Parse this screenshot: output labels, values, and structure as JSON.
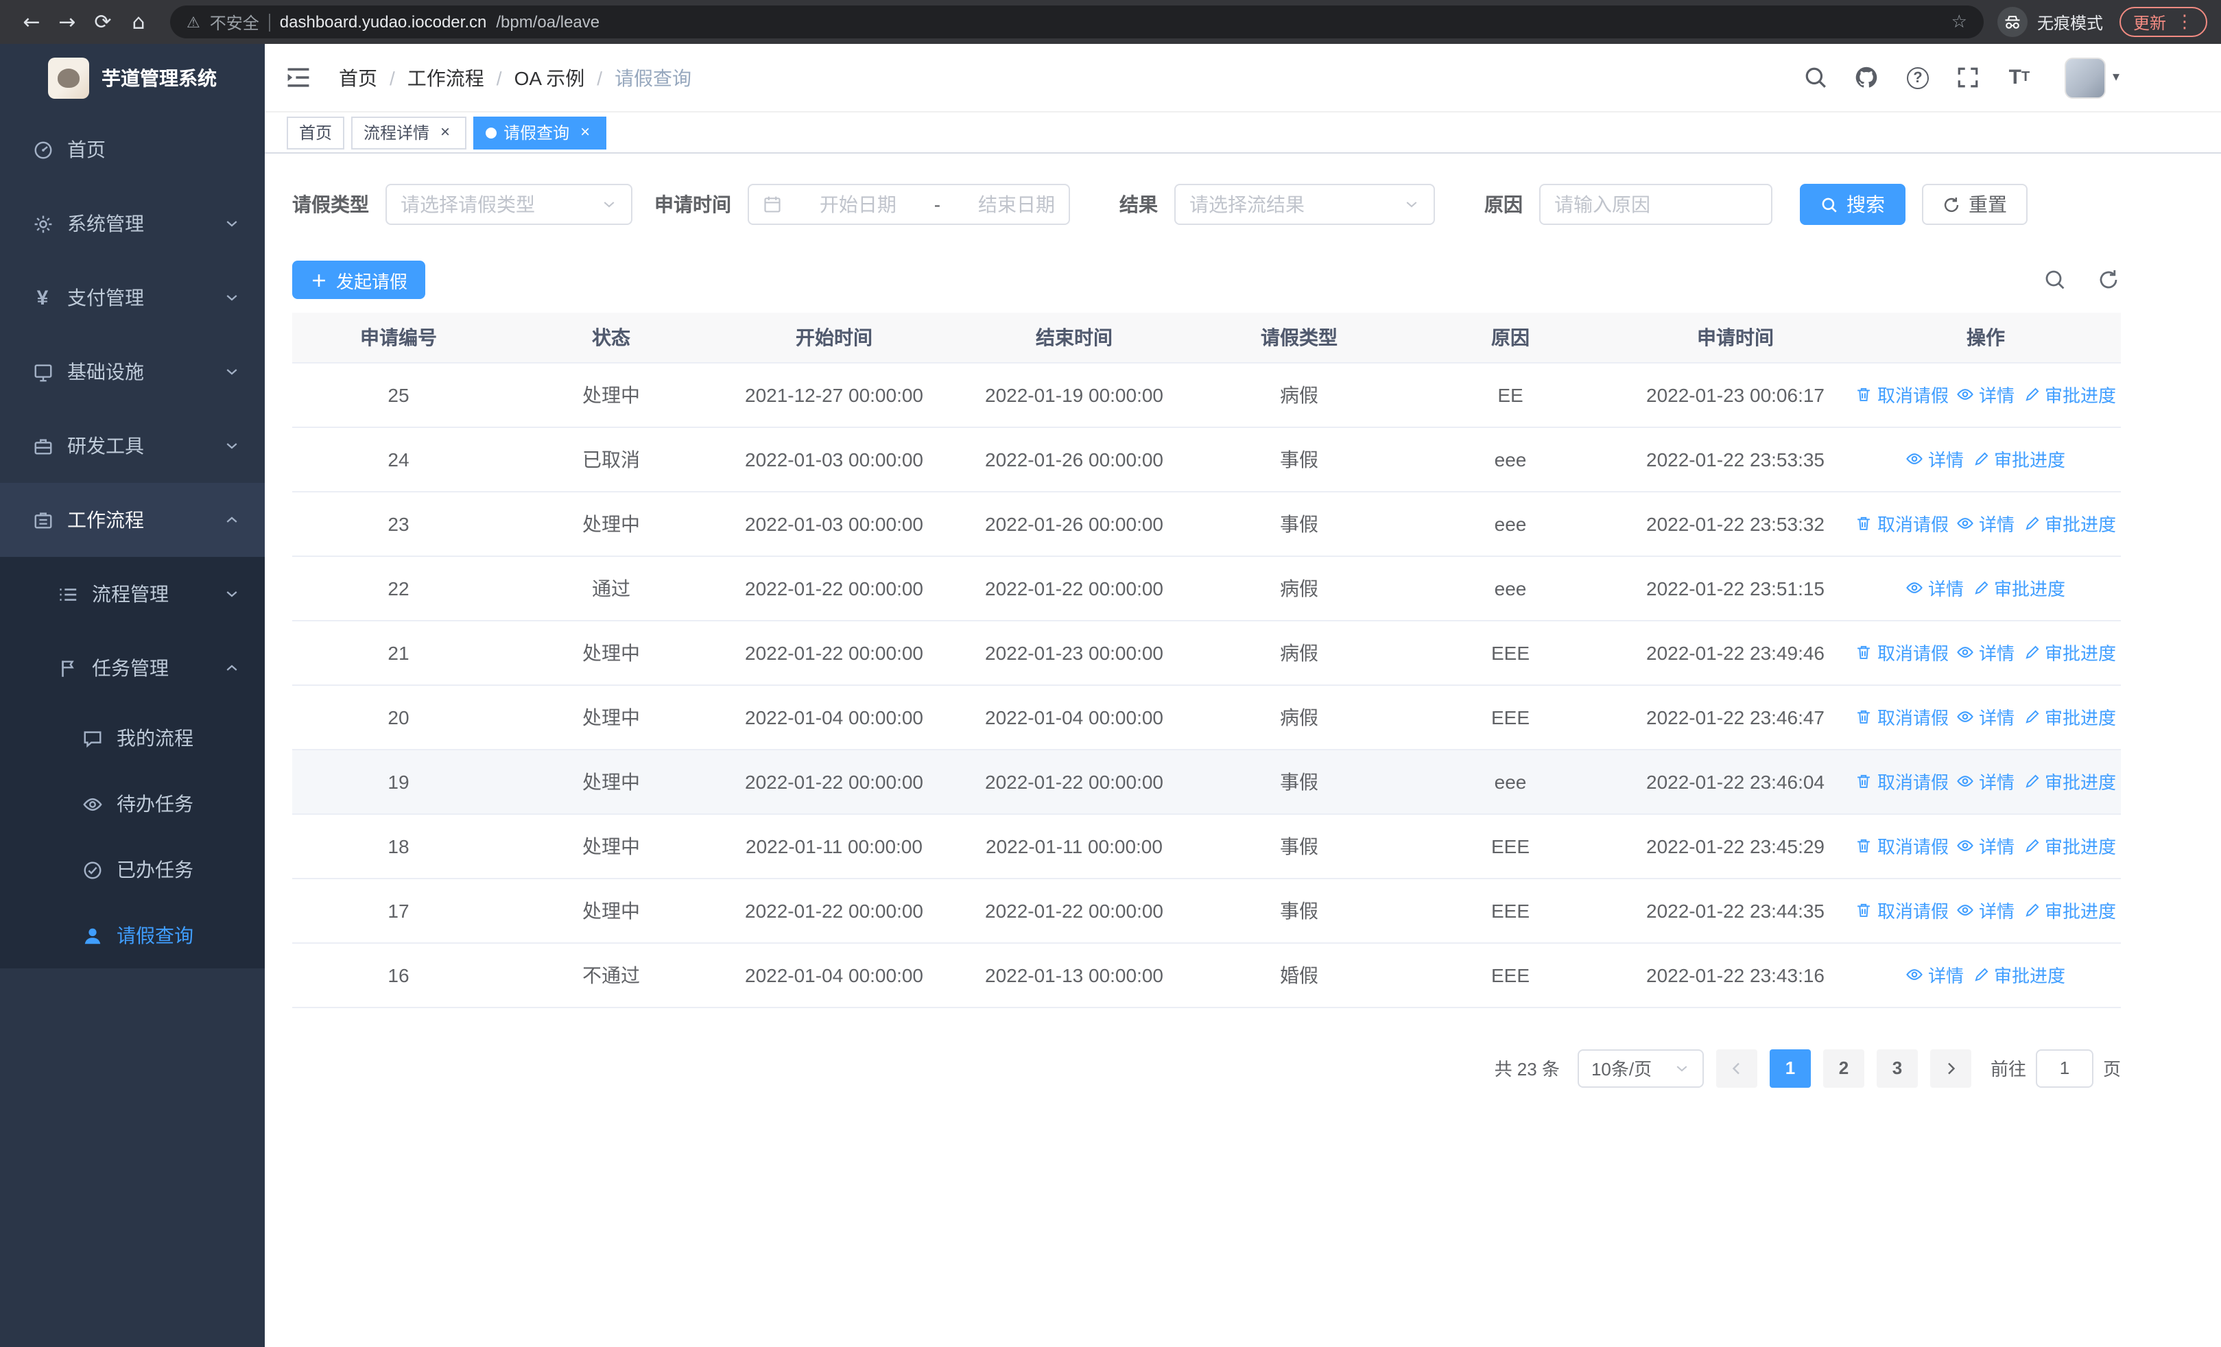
{
  "icons": {
    "back": "←",
    "forward": "→",
    "refresh": "⟳",
    "home": "⌂",
    "star": "☆",
    "kebab": "⋮",
    "warning": "⚠",
    "caret_down": "▾"
  },
  "browser": {
    "security_label": "不安全",
    "url_domain": "dashboard.yudao.iocoder.cn",
    "url_path": "/bpm/oa/leave",
    "incognito_label": "无痕模式",
    "update_label": "更新"
  },
  "sidebar": {
    "app_title": "芋道管理系统",
    "menu": [
      {
        "name": "home",
        "label": "首页",
        "icon": "dashboard-icon",
        "level": 1
      },
      {
        "name": "system",
        "label": "系统管理",
        "icon": "gear-icon",
        "level": 1,
        "chevron": "down"
      },
      {
        "name": "payment",
        "label": "支付管理",
        "icon": "payment-icon",
        "level": 1,
        "chevron": "down"
      },
      {
        "name": "infra",
        "label": "基础设施",
        "icon": "infra-icon",
        "level": 1,
        "chevron": "down"
      },
      {
        "name": "devtools",
        "label": "研发工具",
        "icon": "devtools-icon",
        "level": 1,
        "chevron": "down"
      },
      {
        "name": "workflow",
        "label": "工作流程",
        "icon": "workflow-icon",
        "level": 1,
        "chevron": "up",
        "highlight": true
      },
      {
        "name": "process-mgmt",
        "label": "流程管理",
        "icon": "process-icon",
        "level": 2,
        "chevron": "down",
        "submenu": true
      },
      {
        "name": "task-mgmt",
        "label": "任务管理",
        "icon": "task-icon",
        "level": 2,
        "chevron": "up",
        "submenu": true
      },
      {
        "name": "my-process",
        "label": "我的流程",
        "icon": "chat-icon",
        "level": 3,
        "submenu": true
      },
      {
        "name": "todo-tasks",
        "label": "待办任务",
        "icon": "eye-icon",
        "level": 3,
        "submenu": true
      },
      {
        "name": "done-tasks",
        "label": "已办任务",
        "icon": "check-icon",
        "level": 3,
        "submenu": true
      },
      {
        "name": "leave-query",
        "label": "请假查询",
        "icon": "user-icon",
        "level": 3,
        "submenu": true,
        "active": true
      }
    ]
  },
  "breadcrumb": [
    "首页",
    "工作流程",
    "OA 示例",
    "请假查询"
  ],
  "breadcrumb_separator": "/",
  "tabs": [
    {
      "label": "首页"
    },
    {
      "label": "流程详情",
      "closable": true
    },
    {
      "label": "请假查询",
      "closable": true,
      "active": true
    }
  ],
  "tab_close_glyph": "×",
  "filters": {
    "leave_type_label": "请假类型",
    "leave_type_placeholder": "请选择请假类型",
    "apply_time_label": "申请时间",
    "start_date_placeholder": "开始日期",
    "date_separator": "-",
    "end_date_placeholder": "结束日期",
    "result_label": "结果",
    "result_placeholder": "请选择流结果",
    "reason_label": "原因",
    "reason_placeholder": "请输入原因",
    "search_button": "搜索",
    "reset_button": "重置"
  },
  "toolbar": {
    "create_button": "发起请假"
  },
  "table": {
    "columns": [
      "申请编号",
      "状态",
      "开始时间",
      "结束时间",
      "请假类型",
      "原因",
      "申请时间",
      "操作"
    ],
    "rows": [
      {
        "no": "25",
        "status": "处理中",
        "start": "2021-12-27 00:00:00",
        "end": "2022-01-19 00:00:00",
        "type": "病假",
        "reason": "EE",
        "applied": "2022-01-23 00:06:17",
        "actions": [
          {
            "name": "cancel",
            "icon": "trash-icon",
            "label": "取消请假"
          },
          {
            "name": "detail",
            "icon": "eye-icon",
            "label": "详情"
          },
          {
            "name": "progress",
            "icon": "edit-icon",
            "label": "审批进度"
          }
        ]
      },
      {
        "no": "24",
        "status": "已取消",
        "start": "2022-01-03 00:00:00",
        "end": "2022-01-26 00:00:00",
        "type": "事假",
        "reason": "eee",
        "applied": "2022-01-22 23:53:35",
        "actions": [
          {
            "name": "detail",
            "icon": "eye-icon",
            "label": "详情"
          },
          {
            "name": "progress",
            "icon": "edit-icon",
            "label": "审批进度"
          }
        ]
      },
      {
        "no": "23",
        "status": "处理中",
        "start": "2022-01-03 00:00:00",
        "end": "2022-01-26 00:00:00",
        "type": "事假",
        "reason": "eee",
        "applied": "2022-01-22 23:53:32",
        "actions": [
          {
            "name": "cancel",
            "icon": "trash-icon",
            "label": "取消请假"
          },
          {
            "name": "detail",
            "icon": "eye-icon",
            "label": "详情"
          },
          {
            "name": "progress",
            "icon": "edit-icon",
            "label": "审批进度"
          }
        ]
      },
      {
        "no": "22",
        "status": "通过",
        "start": "2022-01-22 00:00:00",
        "end": "2022-01-22 00:00:00",
        "type": "病假",
        "reason": "eee",
        "applied": "2022-01-22 23:51:15",
        "actions": [
          {
            "name": "detail",
            "icon": "eye-icon",
            "label": "详情"
          },
          {
            "name": "progress",
            "icon": "edit-icon",
            "label": "审批进度"
          }
        ]
      },
      {
        "no": "21",
        "status": "处理中",
        "start": "2022-01-22 00:00:00",
        "end": "2022-01-23 00:00:00",
        "type": "病假",
        "reason": "EEE",
        "applied": "2022-01-22 23:49:46",
        "actions": [
          {
            "name": "cancel",
            "icon": "trash-icon",
            "label": "取消请假"
          },
          {
            "name": "detail",
            "icon": "eye-icon",
            "label": "详情"
          },
          {
            "name": "progress",
            "icon": "edit-icon",
            "label": "审批进度"
          }
        ]
      },
      {
        "no": "20",
        "status": "处理中",
        "start": "2022-01-04 00:00:00",
        "end": "2022-01-04 00:00:00",
        "type": "病假",
        "reason": "EEE",
        "applied": "2022-01-22 23:46:47",
        "actions": [
          {
            "name": "cancel",
            "icon": "trash-icon",
            "label": "取消请假"
          },
          {
            "name": "detail",
            "icon": "eye-icon",
            "label": "详情"
          },
          {
            "name": "progress",
            "icon": "edit-icon",
            "label": "审批进度"
          }
        ]
      },
      {
        "no": "19",
        "status": "处理中",
        "start": "2022-01-22 00:00:00",
        "end": "2022-01-22 00:00:00",
        "type": "事假",
        "reason": "eee",
        "applied": "2022-01-22 23:46:04",
        "highlighted": true,
        "actions": [
          {
            "name": "cancel",
            "icon": "trash-icon",
            "label": "取消请假"
          },
          {
            "name": "detail",
            "icon": "eye-icon",
            "label": "详情"
          },
          {
            "name": "progress",
            "icon": "edit-icon",
            "label": "审批进度"
          }
        ]
      },
      {
        "no": "18",
        "status": "处理中",
        "start": "2022-01-11 00:00:00",
        "end": "2022-01-11 00:00:00",
        "type": "事假",
        "reason": "EEE",
        "applied": "2022-01-22 23:45:29",
        "actions": [
          {
            "name": "cancel",
            "icon": "trash-icon",
            "label": "取消请假"
          },
          {
            "name": "detail",
            "icon": "eye-icon",
            "label": "详情"
          },
          {
            "name": "progress",
            "icon": "edit-icon",
            "label": "审批进度"
          }
        ]
      },
      {
        "no": "17",
        "status": "处理中",
        "start": "2022-01-22 00:00:00",
        "end": "2022-01-22 00:00:00",
        "type": "事假",
        "reason": "EEE",
        "applied": "2022-01-22 23:44:35",
        "actions": [
          {
            "name": "cancel",
            "icon": "trash-icon",
            "label": "取消请假"
          },
          {
            "name": "detail",
            "icon": "eye-icon",
            "label": "详情"
          },
          {
            "name": "progress",
            "icon": "edit-icon",
            "label": "审批进度"
          }
        ]
      },
      {
        "no": "16",
        "status": "不通过",
        "start": "2022-01-04 00:00:00",
        "end": "2022-01-13 00:00:00",
        "type": "婚假",
        "reason": "EEE",
        "applied": "2022-01-22 23:43:16",
        "actions": [
          {
            "name": "detail",
            "icon": "eye-icon",
            "label": "详情"
          },
          {
            "name": "progress",
            "icon": "edit-icon",
            "label": "审批进度"
          }
        ]
      }
    ]
  },
  "pagination": {
    "total_text": "共 23 条",
    "page_size": "10条/页",
    "pages": [
      "1",
      "2",
      "3"
    ],
    "active_page": "1",
    "goto_prefix": "前往",
    "goto_value": "1",
    "goto_suffix": "页"
  },
  "accent_color": "#409eff"
}
